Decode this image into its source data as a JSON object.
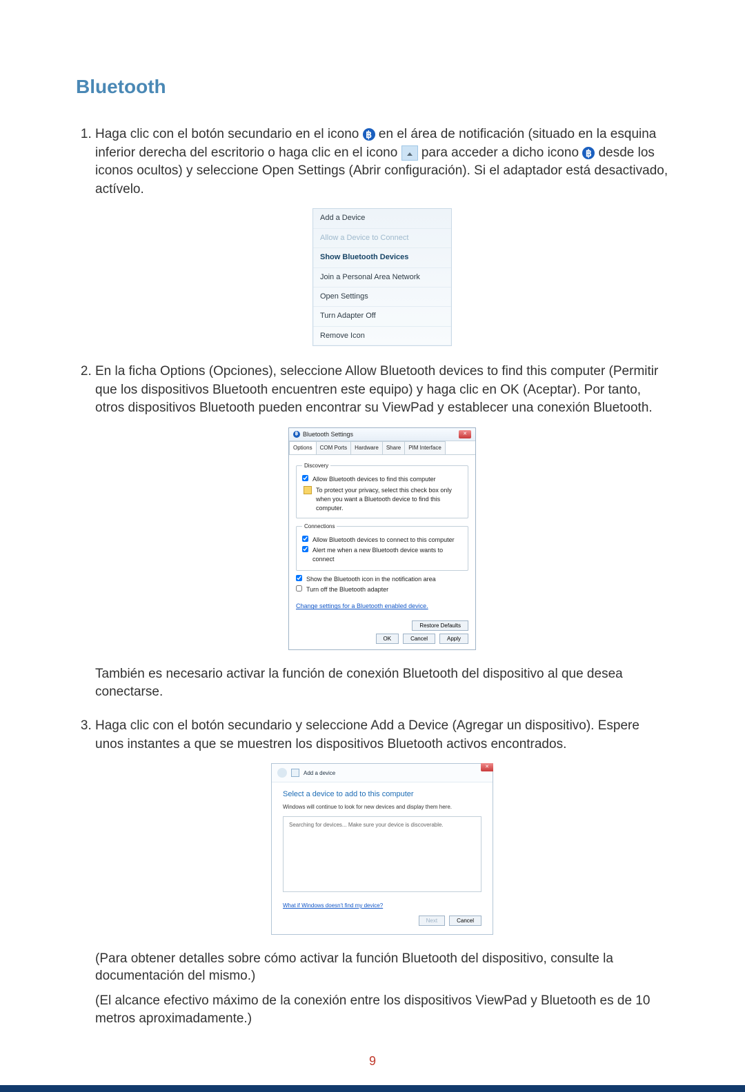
{
  "section_title": "Bluetooth",
  "steps": {
    "1": {
      "pre1": "Haga clic con el botón secundario en el icono ",
      "mid1": " en el área de notificación (situado en la esquina inferior derecha del escritorio o haga clic en el icono ",
      "mid2": " para acceder a dicho icono ",
      "post": " desde los iconos ocultos) y seleccione Open Settings (Abrir configuración). Si el adaptador está desactivado, actívelo."
    },
    "2": {
      "text": "En la ficha Options (Opciones), seleccione Allow Bluetooth devices to find this computer (Permitir que los dispositivos Bluetooth encuentren este equipo) y haga clic en OK (Aceptar). Por tanto, otros dispositivos Bluetooth pueden encontrar su ViewPad y establecer una conexión Bluetooth.",
      "note": "También es necesario activar la función de conexión Bluetooth del dispositivo al que desea conectarse."
    },
    "3": {
      "text": "Haga clic con el botón secundario y seleccione Add a Device (Agregar un dispositivo). Espere unos instantes a que se muestren los dispositivos Bluetooth activos encontrados.",
      "note1": "(Para obtener detalles sobre cómo activar la función Bluetooth del dispositivo, consulte la documentación del mismo.)",
      "note2": "(El alcance efectivo máximo de la conexión entre los dispositivos ViewPad y Bluetooth es de 10 metros aproximadamente.)"
    }
  },
  "context_menu": {
    "items": [
      {
        "label": "Add a Device",
        "cls": ""
      },
      {
        "label": "Allow a Device to Connect",
        "cls": "disabled"
      },
      {
        "label": "Show Bluetooth Devices",
        "cls": "bold"
      },
      {
        "label": "Join a Personal Area Network",
        "cls": ""
      },
      {
        "label": "Open Settings",
        "cls": ""
      },
      {
        "label": "Turn Adapter Off",
        "cls": ""
      },
      {
        "label": "Remove Icon",
        "cls": ""
      }
    ]
  },
  "bt_settings": {
    "title": "Bluetooth Settings",
    "tabs": [
      "Options",
      "COM Ports",
      "Hardware",
      "Share",
      "PIM Interface"
    ],
    "legend_discovery": "Discovery",
    "chk_find": "Allow Bluetooth devices to find this computer",
    "warn": "To protect your privacy, select this check box only when you want a Bluetooth device to find this computer.",
    "legend_conn": "Connections",
    "chk_connect": "Allow Bluetooth devices to connect to this computer",
    "chk_alert": "Alert me when a new Bluetooth device wants to connect",
    "chk_show_icon": "Show the Bluetooth icon in the notification area",
    "chk_turn_off": "Turn off the Bluetooth adapter",
    "link": "Change settings for a Bluetooth enabled device.",
    "btn_restore": "Restore Defaults",
    "btn_ok": "OK",
    "btn_cancel": "Cancel",
    "btn_apply": "Apply"
  },
  "add_device": {
    "crumb": "Add a device",
    "heading": "Select a device to add to this computer",
    "sub": "Windows will continue to look for new devices and display them here.",
    "panel_text": "Searching for devices...   Make sure your device is discoverable.",
    "help": "What if Windows doesn't find my device?",
    "btn_next": "Next",
    "btn_cancel": "Cancel"
  },
  "page_number": "9"
}
